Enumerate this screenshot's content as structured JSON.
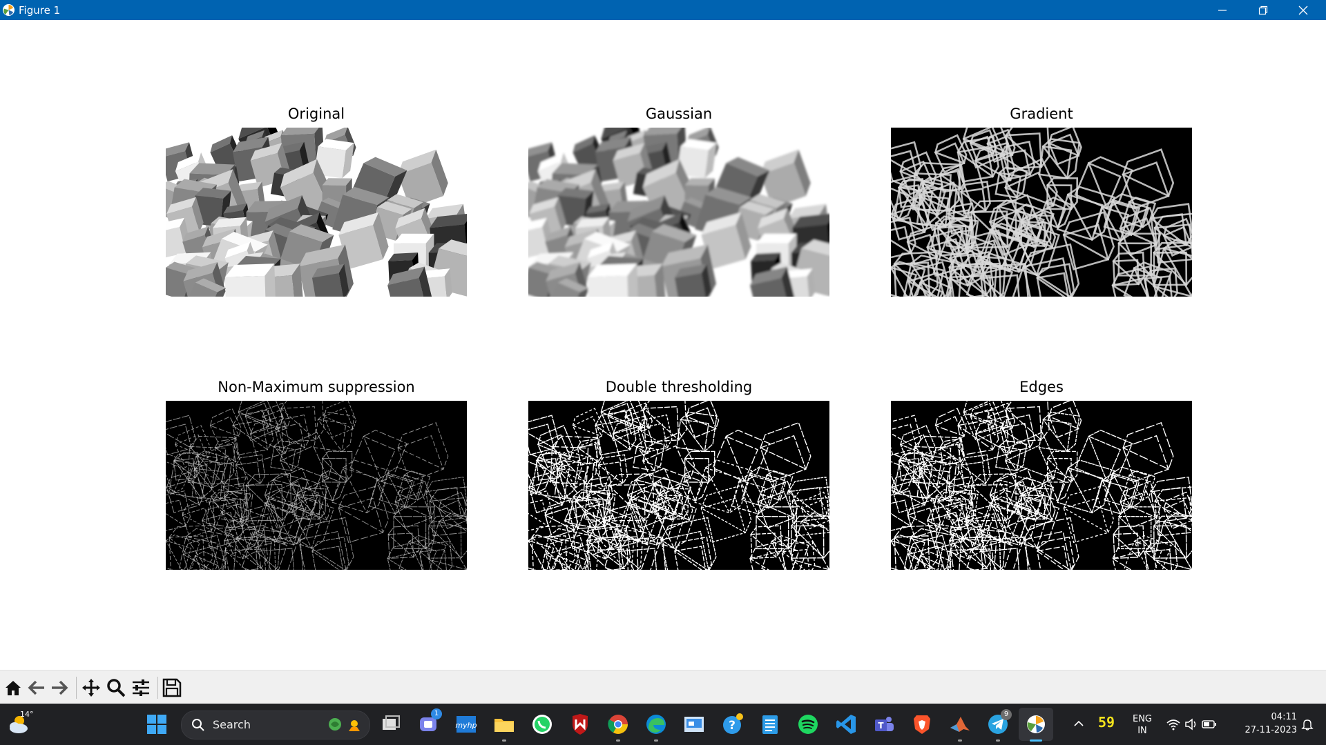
{
  "window": {
    "title": "Figure 1"
  },
  "subplots": [
    {
      "title": "Original"
    },
    {
      "title": "Gaussian"
    },
    {
      "title": "Gradient"
    },
    {
      "title": "Non-Maximum suppression"
    },
    {
      "title": "Double thresholding"
    },
    {
      "title": "Edges"
    }
  ],
  "toolbar": {
    "buttons": [
      "home-icon",
      "back-arrow-icon",
      "forward-arrow-icon",
      "pan-move-icon",
      "zoom-magnifier-icon",
      "configure-subplots-icon",
      "save-floppy-icon"
    ]
  },
  "taskbar": {
    "weather_temp": "14°",
    "search_label": "Search",
    "teams_badge": "1",
    "telegram_badge": "9",
    "tray_number": "59",
    "language": [
      "ENG",
      "IN"
    ],
    "time": "04:11",
    "date": "27-11-2023"
  },
  "colors": {
    "titlebar": "#0063b1",
    "taskbar": "#202124",
    "toolbar": "#f0f0f0",
    "accent": "#4cc2ff"
  }
}
